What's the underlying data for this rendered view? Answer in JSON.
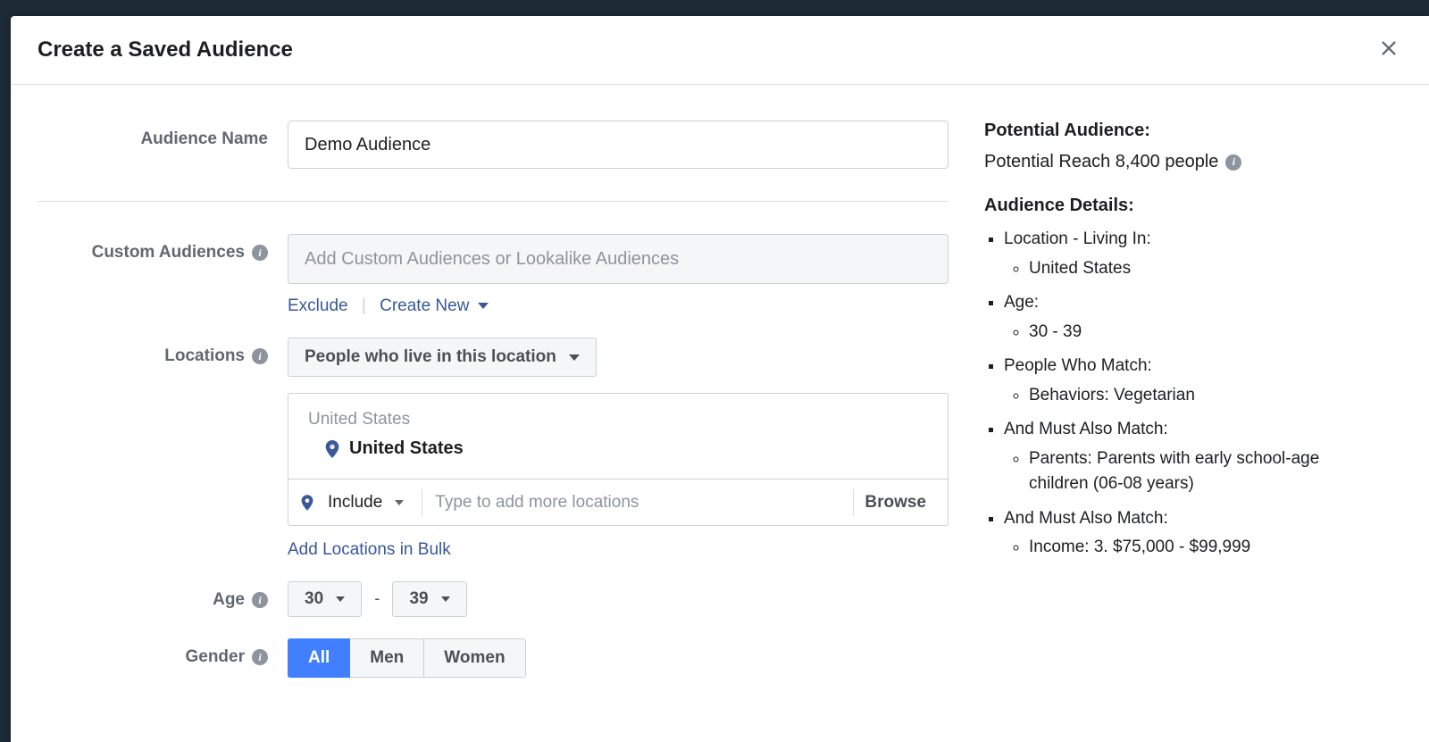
{
  "modal": {
    "title": "Create a Saved Audience"
  },
  "labels": {
    "audience_name": "Audience Name",
    "custom_audiences": "Custom Audiences",
    "locations": "Locations",
    "age": "Age",
    "gender": "Gender"
  },
  "fields": {
    "audience_name_value": "Demo Audience",
    "custom_audiences_placeholder": "Add Custom Audiences or Lookalike Audiences",
    "exclude_link": "Exclude",
    "create_new_link": "Create New",
    "location_type": "People who live in this location",
    "location_group": "United States",
    "location_selected": "United States",
    "include_label": "Include",
    "location_search_placeholder": "Type to add more locations",
    "browse_label": "Browse",
    "bulk_link": "Add Locations in Bulk",
    "age_min": "30",
    "age_max": "39",
    "gender_all": "All",
    "gender_men": "Men",
    "gender_women": "Women"
  },
  "sidebar": {
    "potential_heading": "Potential Audience:",
    "reach_text": "Potential Reach 8,400 people",
    "details_heading": "Audience Details:",
    "details": [
      {
        "label": "Location - Living In:",
        "items": [
          "United States"
        ]
      },
      {
        "label": "Age:",
        "items": [
          "30 - 39"
        ]
      },
      {
        "label": "People Who Match:",
        "items": [
          "Behaviors: Vegetarian"
        ]
      },
      {
        "label": "And Must Also Match:",
        "items": [
          "Parents: Parents with early school-age children (06-08 years)"
        ]
      },
      {
        "label": "And Must Also Match:",
        "items": [
          "Income: 3. $75,000 - $99,999"
        ]
      }
    ]
  }
}
